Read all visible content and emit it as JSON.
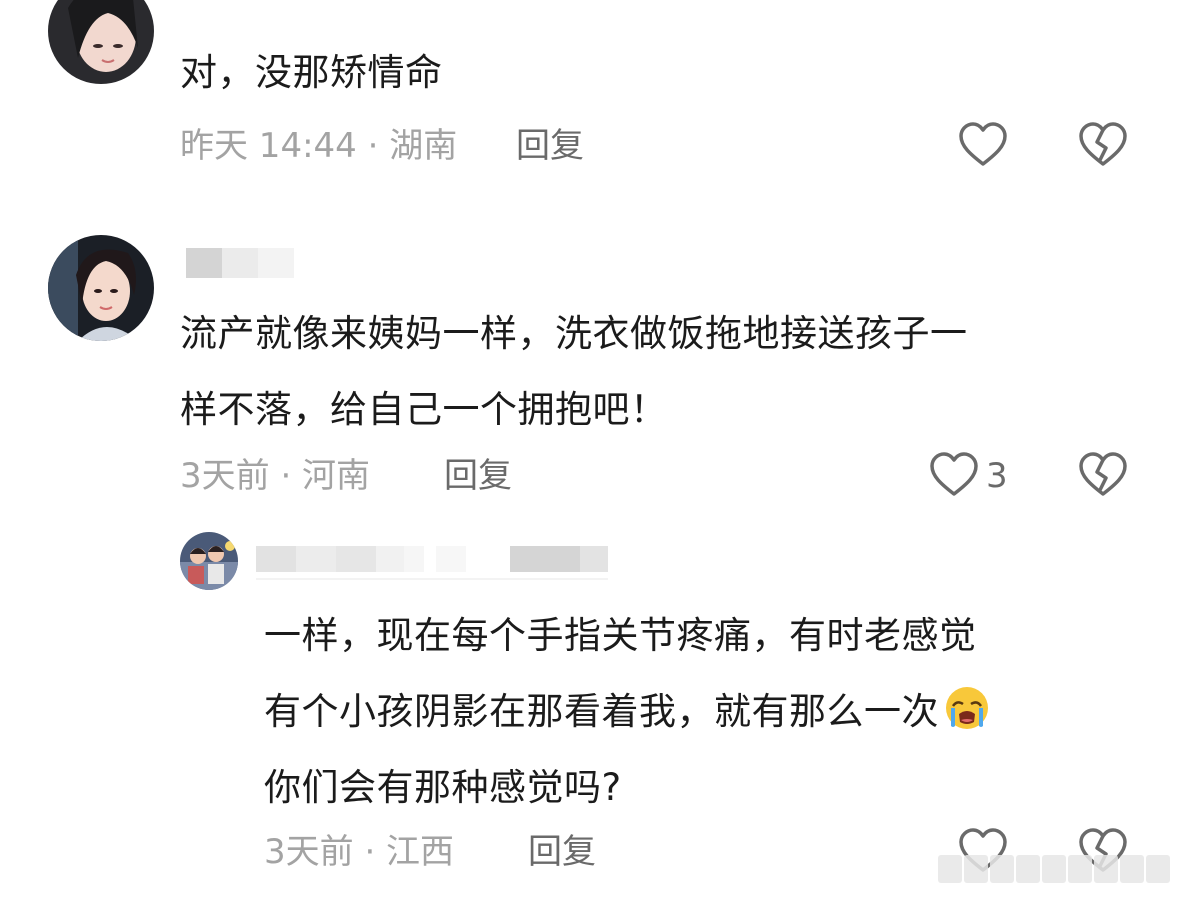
{
  "comments": [
    {
      "text": "对，没那矫情命",
      "time": "昨天 14:44 · 湖南",
      "reply_label": "回复"
    },
    {
      "text_line1": "流产就像来姨妈一样，洗衣做饭拖地接送孩子一",
      "text_line2": "样不落，给自己一个拥抱吧！",
      "time": "3天前 · 河南",
      "reply_label": "回复",
      "like_count": "3"
    }
  ],
  "reply": {
    "text_line1": "一样，现在每个手指关节疼痛，有时老感觉",
    "text_line2": "有个小孩阴影在那看着我，就有那么一次",
    "text_line3": "你们会有那种感觉吗?",
    "emoji": "loudly-crying-face",
    "time": "3天前 · 江西",
    "reply_label": "回复"
  },
  "icons": {
    "like": "heart-outline-icon",
    "dislike": "broken-heart-icon"
  }
}
